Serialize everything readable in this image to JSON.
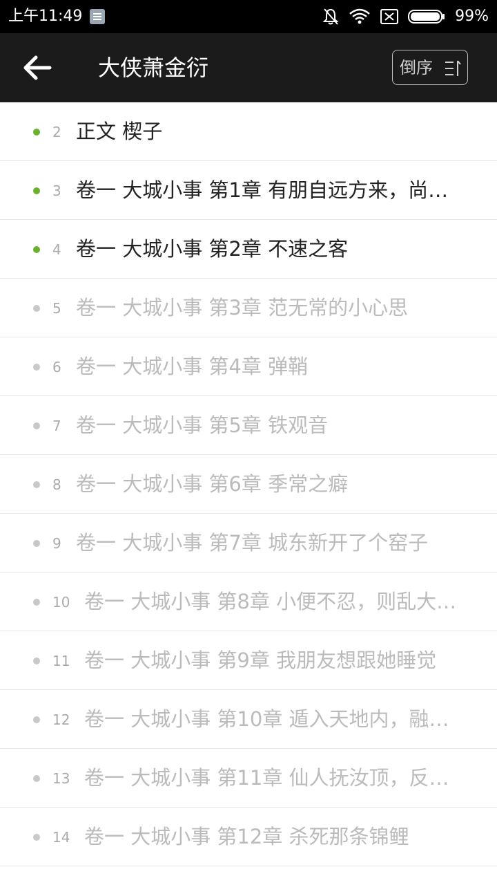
{
  "status_bar": {
    "time": "上午11:49",
    "battery": "99%"
  },
  "app_bar": {
    "title": "大侠萧金衍",
    "sort_label": "倒序"
  },
  "colors": {
    "read_dot": "#6ab22b",
    "unread_dot": "#c8c8c8",
    "read_text": "#222222",
    "unread_text": "#bbbbbb"
  },
  "chapters": [
    {
      "num": "2",
      "title": "正文 楔子",
      "read": true
    },
    {
      "num": "3",
      "title": "卷一 大城小事 第1章 有朋自远方来，尚…",
      "read": true
    },
    {
      "num": "4",
      "title": "卷一 大城小事 第2章 不速之客",
      "read": true
    },
    {
      "num": "5",
      "title": "卷一 大城小事 第3章 范无常的小心思",
      "read": false
    },
    {
      "num": "6",
      "title": "卷一 大城小事 第4章 弹鞘",
      "read": false
    },
    {
      "num": "7",
      "title": "卷一 大城小事 第5章 铁观音",
      "read": false
    },
    {
      "num": "8",
      "title": "卷一 大城小事 第6章 季常之癖",
      "read": false
    },
    {
      "num": "9",
      "title": "卷一 大城小事 第7章 城东新开了个窑子",
      "read": false
    },
    {
      "num": "10",
      "title": "卷一 大城小事 第8章 小便不忍，则乱大…",
      "read": false
    },
    {
      "num": "11",
      "title": "卷一 大城小事 第9章 我朋友想跟她睡觉",
      "read": false
    },
    {
      "num": "12",
      "title": "卷一 大城小事 第10章 遁入天地内，融…",
      "read": false
    },
    {
      "num": "13",
      "title": "卷一 大城小事 第11章 仙人抚汝顶，反…",
      "read": false
    },
    {
      "num": "14",
      "title": "卷一 大城小事 第12章 杀死那条锦鲤",
      "read": false
    }
  ]
}
